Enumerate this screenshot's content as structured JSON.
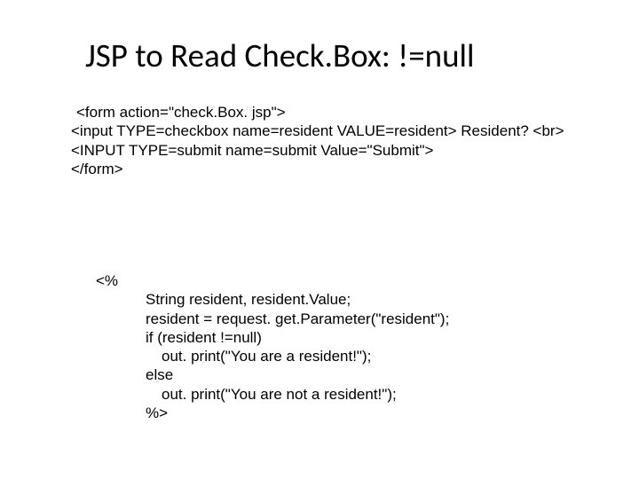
{
  "title": "JSP to Read Check.Box: !=null",
  "form_block": {
    "l1": "<form action=\"check.Box. jsp\">",
    "l2": "<input TYPE=checkbox name=resident VALUE=resident> Resident? <br>",
    "l3": "<INPUT TYPE=submit name=submit Value=\"Submit\">",
    "l4": "</form>"
  },
  "jsp_block": {
    "l1": "<%",
    "l2": "String resident, resident.Value;",
    "l3": "resident = request. get.Parameter(\"resident\");",
    "l4": "if (resident !=null)",
    "l5": "out. print(\"You are a resident!\");",
    "l6": "else",
    "l7": "out. print(\"You are not a resident!\");",
    "l8": "%>"
  }
}
